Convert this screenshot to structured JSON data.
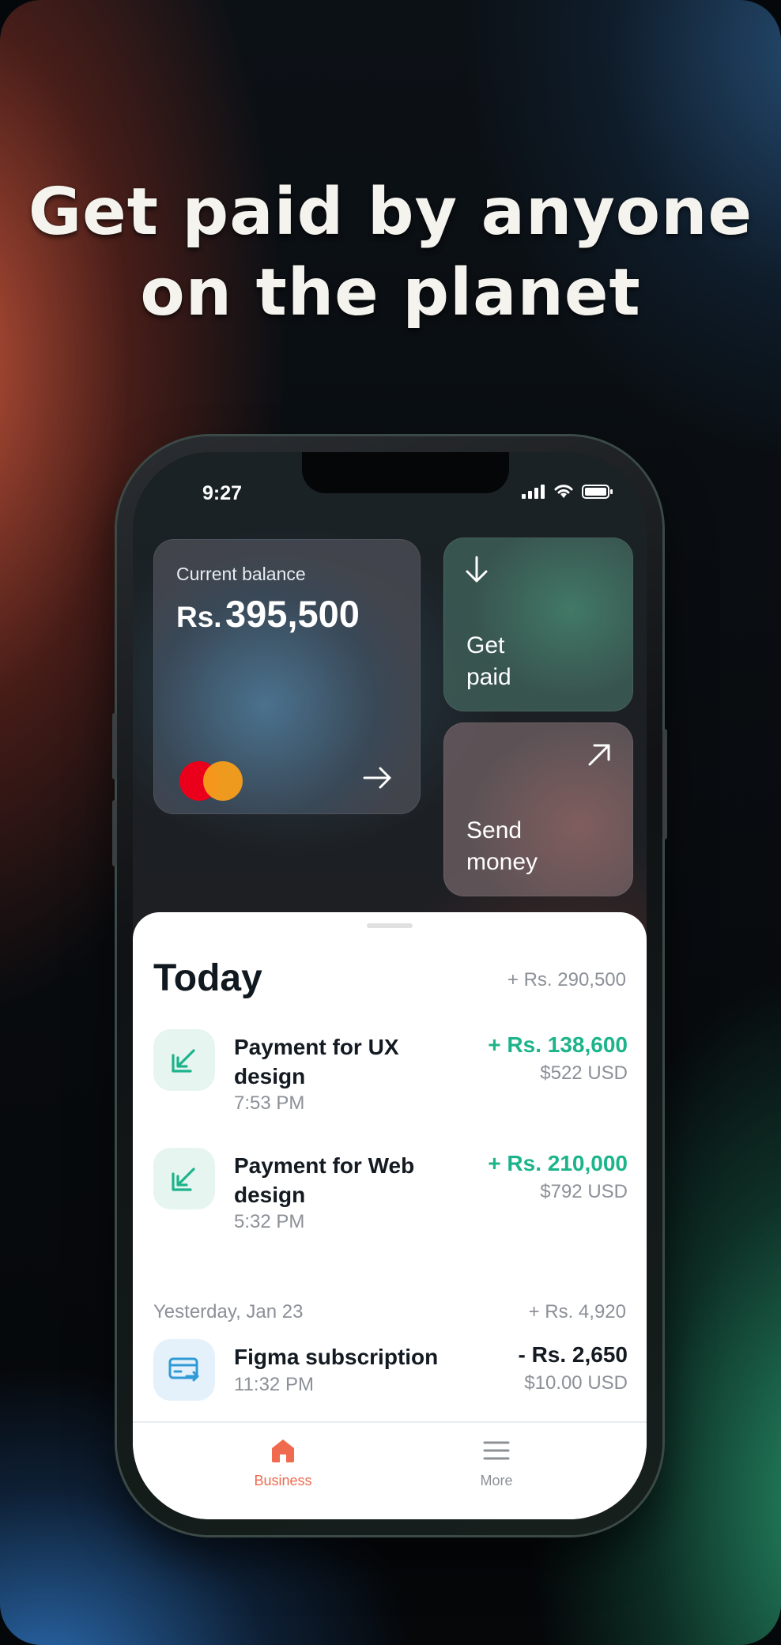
{
  "headline": {
    "line1": "Get paid by anyone",
    "line2": "on the planet"
  },
  "status_bar": {
    "time": "9:27"
  },
  "balance_card": {
    "label": "Current balance",
    "currency": "Rs.",
    "amount": "395,500"
  },
  "actions": {
    "get_paid": {
      "line1": "Get",
      "line2": "paid"
    },
    "send_money": {
      "line1": "Send",
      "line2": "money"
    }
  },
  "today": {
    "title": "Today",
    "total": "+ Rs. 290,500",
    "transactions": [
      {
        "title": "Payment for UX design",
        "time": "7:53 PM",
        "amount": "+ Rs. 138,600",
        "usd": "$522 USD"
      },
      {
        "title": "Payment for Web design",
        "time": "5:32 PM",
        "amount": "+ Rs. 210,000",
        "usd": "$792 USD"
      }
    ]
  },
  "yesterday": {
    "title": "Yesterday, Jan 23",
    "total": "+ Rs. 4,920",
    "transactions": [
      {
        "title": "Figma subscription",
        "time": "11:32 PM",
        "amount": "- Rs. 2,650",
        "usd": "$10.00 USD"
      }
    ]
  },
  "tabs": [
    {
      "label": "Business",
      "icon": "home-icon",
      "active": true
    },
    {
      "label": "More",
      "icon": "menu-icon",
      "active": false
    }
  ],
  "colors": {
    "accent_green": "#1db48b",
    "active_tab": "#ef6a4f",
    "inactive_tab": "#8c9097"
  }
}
